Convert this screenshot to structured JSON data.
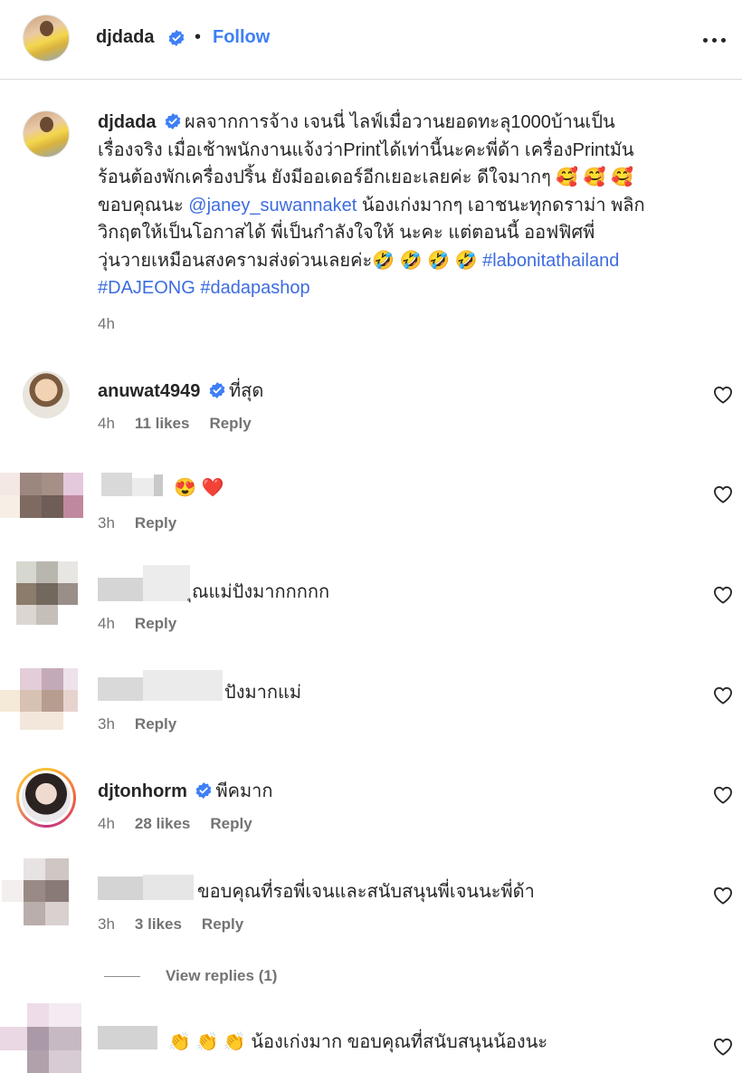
{
  "post": {
    "author": "djdada",
    "follow_label": "Follow",
    "separator": "•",
    "caption_user": "djdada",
    "caption_line1": "ผลจากการจ้าง เจนนี่ ไลฟ์เมื่อวานยอดทะลุ1000บ้านเป็น",
    "caption_line2": "เรื่องจริง เมื่อเช้าพนักงานแจ้งว่าPrintได้เท่านี้นะคะพี่ด้า เครื่องPrintมัน",
    "caption_line3": "ร้อนต้องพักเครื่องปริ้น ยังมีออเดอร์อีกเยอะเลยค่ะ ดีใจมากๆ 🥰 🥰 🥰",
    "caption_line4_pre": "ขอบคุณนะ ",
    "caption_mention": "@janey_suwannaket",
    "caption_line4_post": " น้องเก่งมากๆ เอาชนะทุกดราม่า พลิก",
    "caption_line5": "วิกฤตให้เป็นโอกาสได้ พี่เป็นกำลังใจให้ นะคะ แต่ตอนนี้ ออฟฟิศพี่",
    "caption_line6": "วุ่นวายเหมือนสงครามส่งด่วนเลยค่ะ🤣 🤣 🤣 🤣 ",
    "hashtag1": "#labonitathailand",
    "hashtag2": "#DAJEONG",
    "hashtag3": "#dadapashop",
    "time": "4h"
  },
  "comments": [
    {
      "user": "anuwat4949",
      "text": "ที่สุด",
      "time": "4h",
      "likes": "11 likes",
      "reply": "Reply"
    },
    {
      "user": "",
      "text": "😍 ❤️",
      "time": "3h",
      "likes": "",
      "reply": "Reply"
    },
    {
      "user": "",
      "text": "ุณแม่ปังมากกกกก",
      "time": "4h",
      "likes": "",
      "reply": "Reply"
    },
    {
      "user": "",
      "text": "ปังมากแม่",
      "time": "3h",
      "likes": "",
      "reply": "Reply"
    },
    {
      "user": "djtonhorm",
      "text": "พีคมาก",
      "time": "4h",
      "likes": "28 likes",
      "reply": "Reply"
    },
    {
      "user": "",
      "text": "ขอบคุณที่รอพี่เจนและสนับสนุนพี่เจนนะพี่ด้า",
      "time": "3h",
      "likes": "3 likes",
      "reply": "Reply"
    },
    {
      "user": "",
      "text": "👏 👏 👏 น้องเก่งมาก ขอบคุณที่สนับสนุนน้องนะ",
      "time": "",
      "likes": "",
      "reply": ""
    }
  ],
  "view_replies": "View replies (1)",
  "icons": {
    "verified": "verified-badge-icon",
    "more": "more-options-icon",
    "heart": "heart-outline-icon"
  },
  "colors": {
    "accent": "#3d7ff7",
    "verified": "#3d7ff7",
    "muted": "#737373",
    "mention": "#3d6ce0"
  }
}
